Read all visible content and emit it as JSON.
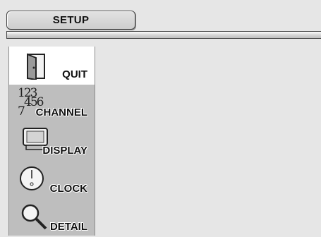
{
  "header": {
    "title": "SETUP"
  },
  "menu": {
    "items": [
      {
        "label": "QUIT",
        "icon": "door-icon",
        "selected": true
      },
      {
        "label": "CHANNEL",
        "icon": "channel-numbers-icon",
        "selected": false
      },
      {
        "label": "DISPLAY",
        "icon": "monitor-icon",
        "selected": false
      },
      {
        "label": "CLOCK",
        "icon": "clock-icon",
        "selected": false
      },
      {
        "label": "DETAIL",
        "icon": "magnifier-icon",
        "selected": false
      }
    ],
    "channel_icon_text": {
      "row1": "123",
      "row2": "456",
      "row3": "7"
    }
  },
  "colors": {
    "background": "#e6e6e6",
    "sidebar": "#bebebe",
    "selected": "#ffffff"
  }
}
